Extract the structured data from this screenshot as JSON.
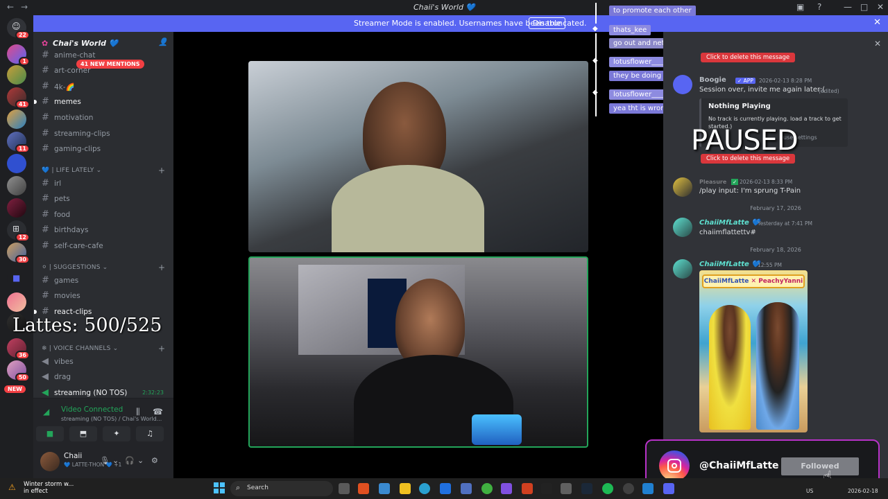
{
  "titlebar": {
    "title": "Chaii's World 💙"
  },
  "banner": {
    "text": "Streamer Mode is enabled. Usernames have been truncated.",
    "button": "Disable"
  },
  "rail": {
    "badges": [
      "22",
      "1",
      "41",
      "11",
      "12",
      "30",
      "36",
      "50"
    ],
    "new_label": "NEW"
  },
  "sidebar": {
    "server_name": "Chai's World 💙",
    "mentions": "41 NEW MENTIONS",
    "channels_top": [
      {
        "label": "anime-chat"
      },
      {
        "label": "art-corner"
      },
      {
        "label": "4k-🌈"
      },
      {
        "label": "memes"
      },
      {
        "label": "motivation"
      },
      {
        "label": "streaming-clips"
      },
      {
        "label": "gaming-clips"
      }
    ],
    "cat_life": "💙 | LIFE LATELY",
    "channels_life": [
      {
        "label": "irl"
      },
      {
        "label": "pets"
      },
      {
        "label": "food"
      },
      {
        "label": "birthdays"
      },
      {
        "label": "self-care-cafe"
      }
    ],
    "cat_suggestions": "⚪ | SUGGESTIONS",
    "channels_sugg": [
      {
        "label": "games"
      },
      {
        "label": "movies"
      },
      {
        "label": "react-clips"
      }
    ],
    "cat_voice": "❄ | VOICE CHANNELS",
    "channels_voice": [
      {
        "label": "vibes"
      },
      {
        "label": "drag"
      },
      {
        "label": "streaming (NO TOS)",
        "timer": "2:32:23"
      }
    ],
    "lattes_overlay": "Lattes: 500/525",
    "voice_connected": {
      "title": "Video Connected",
      "subtitle": "streaming (NO TOS) / Chai's World..."
    },
    "user": {
      "name": "Chaii",
      "status": "💙 LATTE-THON 💙 +1"
    }
  },
  "chat_overlay": [
    {
      "kind": "msg",
      "text": "to promote each other"
    },
    {
      "kind": "user",
      "text": "thats_kee"
    },
    {
      "kind": "msg",
      "text": "go out and network n grow your own community"
    },
    {
      "kind": "user",
      "text": "lotusflower____"
    },
    {
      "kind": "msg",
      "text": "they be doing tht on purpose"
    },
    {
      "kind": "user",
      "text": "lotusflower____"
    },
    {
      "kind": "msg",
      "text": "yea tht is wrong"
    }
  ],
  "messages": {
    "delete_label": "Click to delete this message",
    "bot_name": "Boogie",
    "bot_tag": "✓ APP",
    "bot_time": "2026-02-13 8:28 PM",
    "bot_text": "Session over, invite me again later:(",
    "bot_edited": "(edited)",
    "embed_title": "Nothing Playing",
    "embed_desc": "No track is currently playing. load a track to get started.)",
    "embed_extra": "use settings",
    "paused": "PAUSED",
    "user2_name": "Pleasure",
    "user2_time": "2026-02-13 8:33 PM",
    "user2_text": "/play input: I'm sprung T-Pain",
    "date1": "February 17, 2026",
    "m1_name": "ChaiiMfLatte 💙",
    "m1_time": "Yesterday at 7:41 PM",
    "m1_text": "chaiimflattettv#",
    "date2": "February 18, 2026",
    "m2_name": "ChaiiMfLatte 💙",
    "m2_time": "12:55 PM",
    "art_left": "ChaiiMfLatte",
    "art_right": "PeachyYanni"
  },
  "ig_popup": {
    "handle": "@ChaiiMfLatte",
    "button": "Followed"
  },
  "taskbar": {
    "weather_title": "Winter storm w...",
    "weather_sub": "in effect",
    "search": "Search",
    "lang": "US",
    "clock": "2026-02-18"
  }
}
